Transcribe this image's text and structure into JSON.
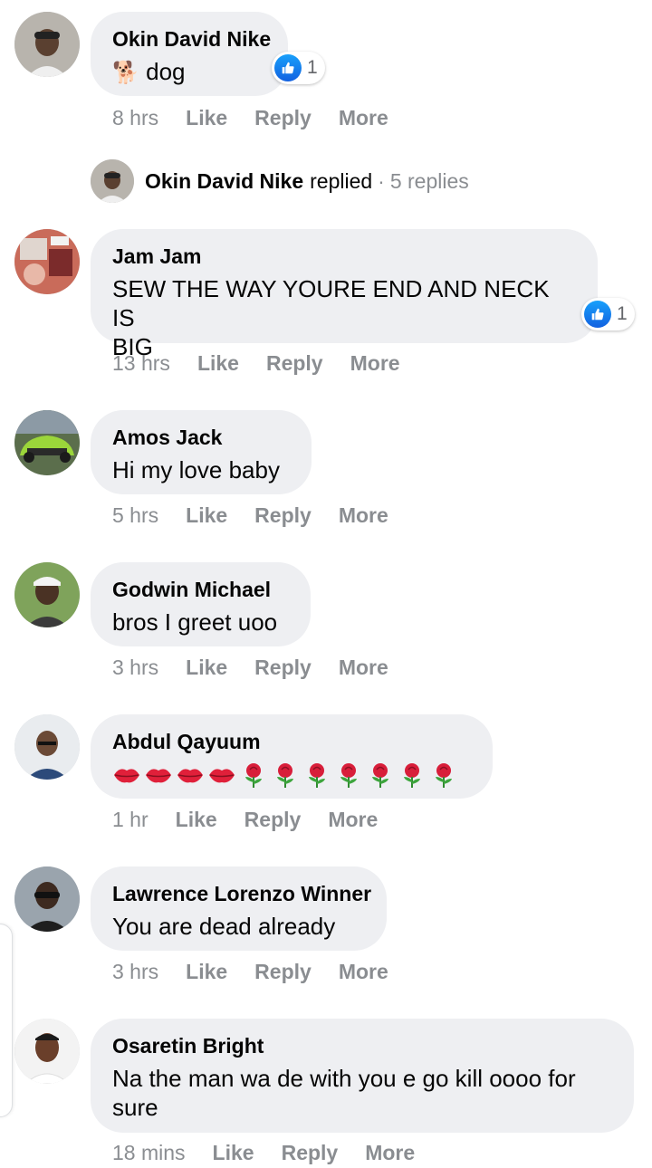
{
  "comments": [
    {
      "author": "Okin David Nike",
      "text": "dog",
      "emoji": "🐕",
      "time": "8 hrs",
      "like": "Like",
      "reply": "Reply",
      "more": "More",
      "reaction_count": "1"
    },
    {
      "author": "Jam Jam",
      "text_line1": "SEW THE WAY YOURE END AND NECK IS",
      "text_line2": "BIG",
      "time": "13 hrs",
      "like": "Like",
      "reply": "Reply",
      "more": "More",
      "reaction_count": "1"
    },
    {
      "author": "Amos Jack",
      "text": "Hi my love baby",
      "time": "5 hrs",
      "like": "Like",
      "reply": "Reply",
      "more": "More"
    },
    {
      "author": "Godwin Michael",
      "text": "bros I greet uoo",
      "time": "3 hrs",
      "like": "Like",
      "reply": "Reply",
      "more": "More"
    },
    {
      "author": "Abdul Qayuum",
      "emoji_text": "💋💋💋💋🌹🌹🌹🌹🌹🌹🌹",
      "time": "1 hr",
      "like": "Like",
      "reply": "Reply",
      "more": "More"
    },
    {
      "author": "Lawrence Lorenzo Winner",
      "text": "You are dead already",
      "time": "3 hrs",
      "like": "Like",
      "reply": "Reply",
      "more": "More"
    },
    {
      "author": "Osaretin Bright",
      "text_line1": "Na the man wa de with you e go kill oooo for",
      "text_line2": "sure",
      "time": "18 mins",
      "like": "Like",
      "reply": "Reply",
      "more": "More"
    }
  ],
  "replied_summary": {
    "name": "Okin David Nike",
    "action": "replied",
    "separator": "·",
    "count": "5 replies"
  },
  "colors": {
    "bubble": "#eeeff2",
    "secondary_text": "#8a8d91",
    "like_blue": "#1877f2"
  },
  "icons": {
    "reaction": "like-thumb-icon",
    "emoji_kiss": "lips-emoji",
    "emoji_rose": "rose-emoji",
    "emoji_dog": "dog-emoji"
  }
}
